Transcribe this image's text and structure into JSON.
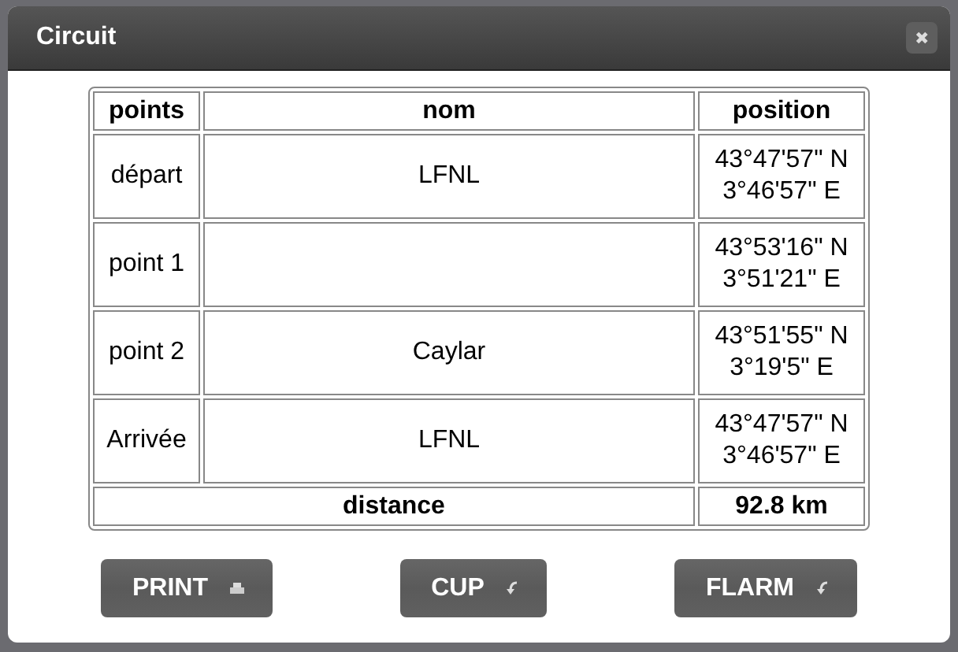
{
  "window": {
    "title": "Circuit",
    "close": "✖"
  },
  "table": {
    "columns": [
      "points",
      "nom",
      "position"
    ],
    "rows": [
      {
        "point": "départ",
        "nom": "LFNL",
        "position": [
          "43°47'57\" N",
          "3°46'57\" E"
        ]
      },
      {
        "point": "point 1",
        "position": [
          "43°53'16\" N",
          "3°51'21\" E"
        ]
      },
      {
        "point": "point 2",
        "nom": "Caylar",
        "position": [
          "43°51'55\" N",
          "3°19'5\" E"
        ]
      },
      {
        "point": "Arrivée",
        "nom": "LFNL",
        "position": [
          "43°47'57\" N",
          "3°46'57\" E"
        ]
      }
    ],
    "footer": {
      "label": "distance",
      "value": "92.8 km"
    }
  },
  "buttons": [
    {
      "label": "PRINT",
      "kind": "print"
    },
    {
      "label": "CUP",
      "kind": "export"
    },
    {
      "label": "FLARM",
      "kind": "export"
    }
  ]
}
